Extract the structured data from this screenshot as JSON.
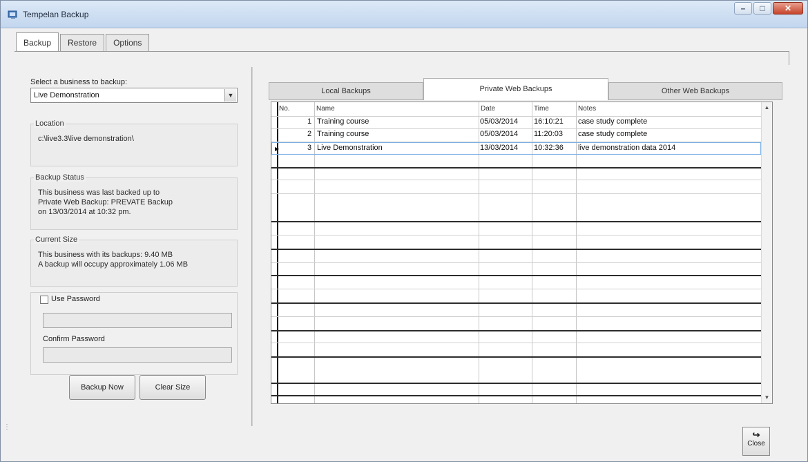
{
  "window": {
    "title": "Tempelan Backup"
  },
  "tabs": [
    {
      "label": "Backup"
    },
    {
      "label": "Restore"
    },
    {
      "label": "Options"
    }
  ],
  "left": {
    "select_label": "Select a business to backup:",
    "selected_business": "Live Demonstration",
    "location": {
      "title": "Location",
      "text": "c:\\live3.3\\live demonstration\\"
    },
    "backup_status": {
      "title": "Backup Status",
      "lines": [
        "This business was last backed up to",
        "Private Web Backup: PREVATE Backup",
        "on 13/03/2014 at 10:32 pm."
      ]
    },
    "current_size": {
      "title": "Current Size",
      "lines": [
        "This business with its backups: 9.40 MB",
        "A backup will occupy approximately 1.06 MB"
      ]
    },
    "use_password_label": "Use Password",
    "confirm_password_label": "Confirm Password",
    "backup_now_label": "Backup Now",
    "clear_size_label": "Clear Size"
  },
  "right": {
    "tabs": [
      {
        "label": "Local Backups"
      },
      {
        "label": "Private Web Backups"
      },
      {
        "label": "Other Web Backups"
      }
    ],
    "columns": [
      "No.",
      "Name",
      "Date",
      "Time",
      "Notes"
    ],
    "rows": [
      {
        "no": "1",
        "name": "Training course",
        "date": "05/03/2014",
        "time": "16:10:21",
        "notes": "case study complete"
      },
      {
        "no": "2",
        "name": "Training course",
        "date": "05/03/2014",
        "time": "11:20:03",
        "notes": "case study complete"
      },
      {
        "no": "3",
        "name": "Live Demonstration",
        "date": "13/03/2014",
        "time": "10:32:36",
        "notes": "live demonstration data 2014"
      }
    ],
    "selected_row_index": 2
  },
  "close_label": "Close"
}
